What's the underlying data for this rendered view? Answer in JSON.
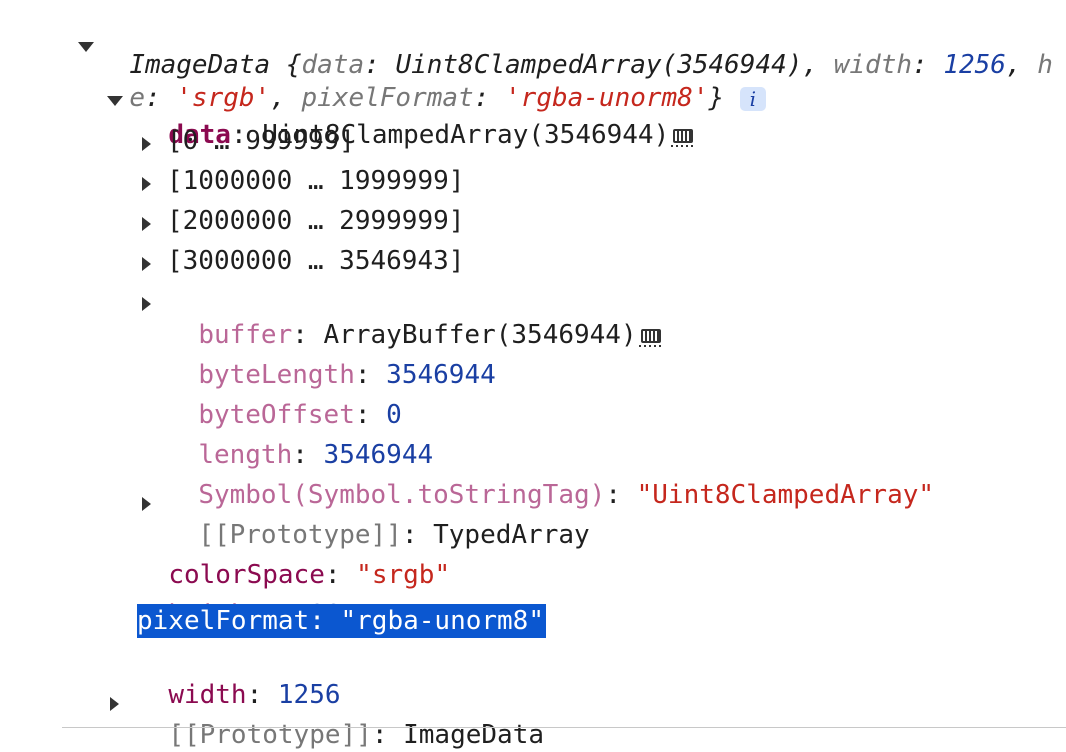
{
  "summary": {
    "line1": {
      "prefix": "ImageData {",
      "k_data": "data",
      "v_data": "Uint8ClampedArray(3546944)",
      "k_width": "width",
      "v_width": "1256",
      "tail": "h"
    },
    "line2": {
      "cont": "e",
      "k_colorSpace_tail": ":",
      "v_srgb": "'srgb'",
      "k_pixelFormat": "pixelFormat",
      "v_pixelFormat": "'rgba-unorm8'",
      "close": "}"
    },
    "info_glyph": "i"
  },
  "data_node": {
    "key": "data",
    "value": "Uint8ClampedArray(3546944)"
  },
  "ranges": [
    "[0 … 999999]",
    "[1000000 … 1999999]",
    "[2000000 … 2999999]",
    "[3000000 … 3546943]"
  ],
  "buffer": {
    "key": "buffer",
    "value": "ArrayBuffer(3546944)"
  },
  "props": {
    "byteLength": {
      "key": "byteLength",
      "value": "3546944"
    },
    "byteOffset": {
      "key": "byteOffset",
      "value": "0"
    },
    "length": {
      "key": "length",
      "value": "3546944"
    },
    "symbol": {
      "key": "Symbol(Symbol.toStringTag)",
      "value": "\"Uint8ClampedArray\""
    }
  },
  "data_proto": {
    "key": "[[Prototype]]",
    "value": "TypedArray"
  },
  "top": {
    "colorSpace": {
      "key": "colorSpace",
      "value": "\"srgb\""
    },
    "height": {
      "key": "height",
      "value": "706"
    },
    "pixelFormat": {
      "key": "pixelFormat",
      "value": "\"rgba-unorm8\""
    },
    "width": {
      "key": "width",
      "value": "1256"
    }
  },
  "root_proto": {
    "key": "[[Prototype]]",
    "value": "ImageData"
  },
  "colors": {
    "selection": "#0b57d0",
    "string": "#c5271d",
    "number": "#1a3fa3",
    "own_key": "#8b0a50",
    "internal_key": "#ba6797"
  }
}
